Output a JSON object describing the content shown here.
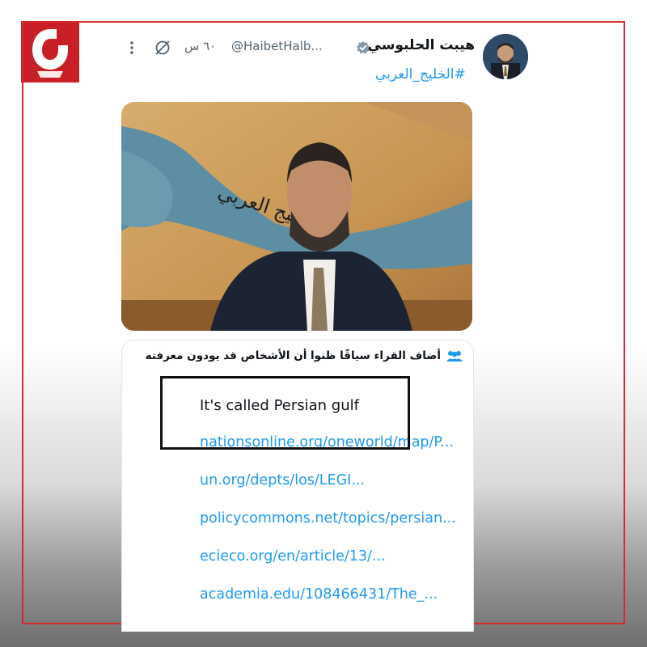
{
  "post": {
    "display_name": "هيبت الحلبوسي",
    "handle": "@HaibetHalb...",
    "timestamp": "٦٠ س",
    "hashtag": "#الخليج_العربي",
    "media": {
      "map_caption": "الخليج العربي"
    }
  },
  "community_note": {
    "heading": "أضاف القراء سياقًا ظنوا أن الأشخاص قد يودون معرفته",
    "text": "It's called Persian gulf",
    "links": [
      "nationsonline.org/oneworld/map/P...",
      "un.org/depts/los/LEGI...",
      "policycommons.net/topics/persian...",
      "ecieco.org/en/article/13/...",
      "academia.edu/108466431/The_..."
    ]
  },
  "icons": {
    "verified": "verified-badge-icon",
    "grok": "grok-icon",
    "more": "more-options-icon",
    "people": "people-icon",
    "logo": "channel-logo-icon"
  },
  "colors": {
    "frame": "#d52b2b",
    "logo": "#c81f26",
    "link": "#1d9bf0",
    "annotation_box": "#111111"
  }
}
